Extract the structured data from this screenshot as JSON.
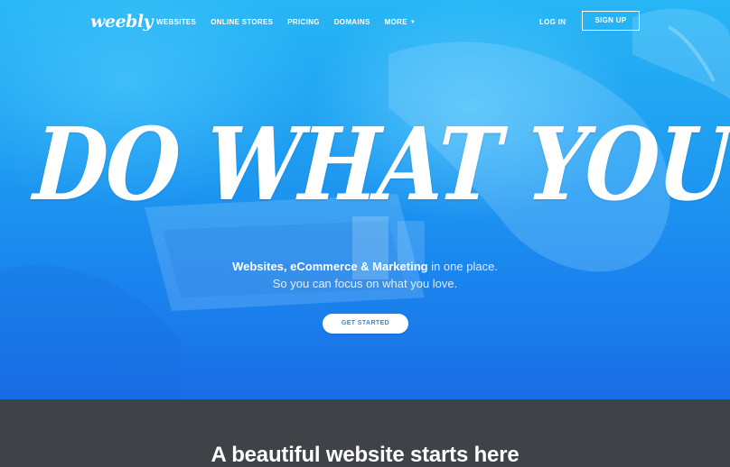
{
  "nav": {
    "logo": "weebly",
    "links": [
      "WEBSITES",
      "ONLINE STORES",
      "PRICING",
      "DOMAINS",
      "MORE"
    ],
    "login": "LOG IN",
    "signup": "SIGN UP"
  },
  "hero": {
    "headline": "DO WHAT YOU LOVE",
    "tagline_bold": "Websites, eCommerce & Marketing",
    "tagline_rest": " in one place.",
    "tagline_line2": "So you can focus on what you love.",
    "cta": "GET STARTED"
  },
  "section": {
    "title": "A beautiful website starts here"
  },
  "colors": {
    "hero_blue": "#1f9ff2",
    "dark_section": "#3f4347",
    "cta_text": "#2a8bee"
  }
}
